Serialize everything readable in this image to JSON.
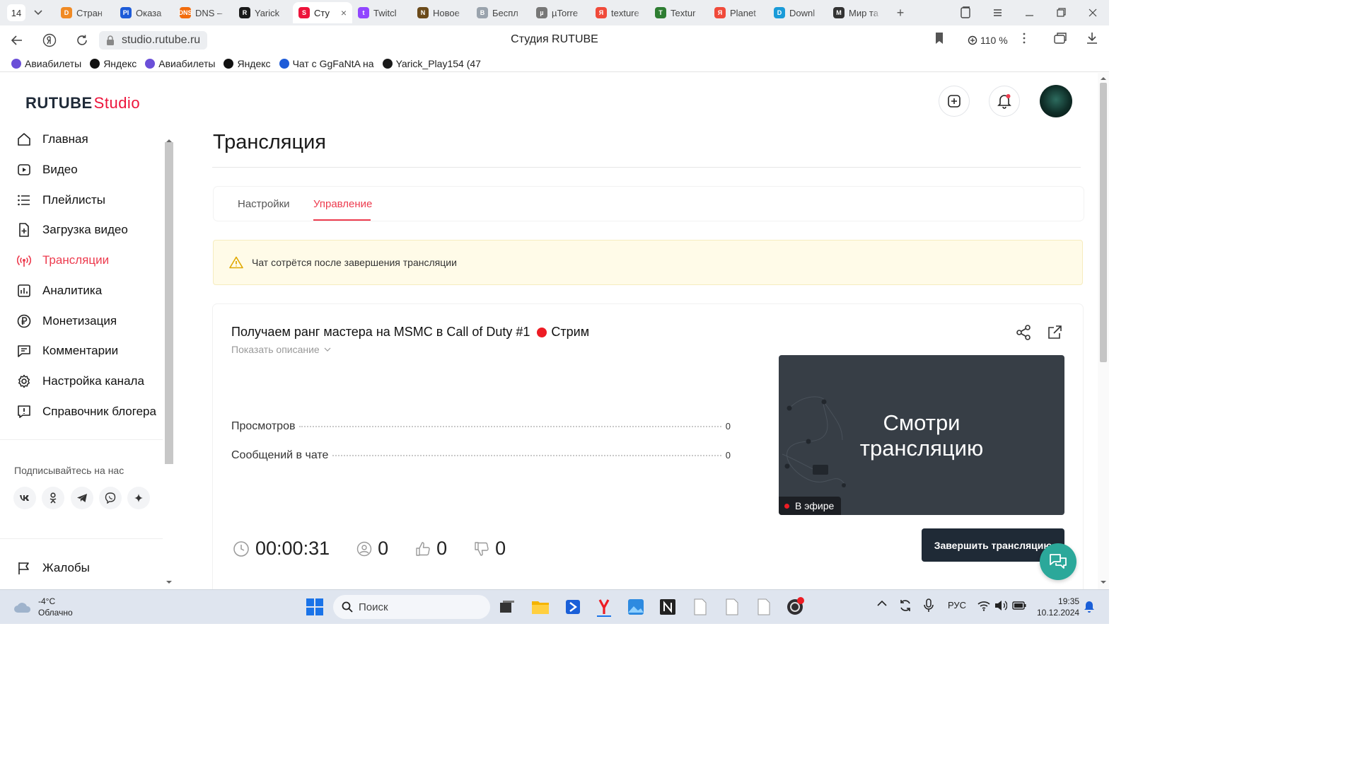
{
  "browser": {
    "tab_count": "14",
    "tabs": [
      {
        "title": "Стран",
        "color": "#f08a24",
        "letter": "D"
      },
      {
        "title": "Оказа",
        "color": "#1d5bd8",
        "letter": "PI"
      },
      {
        "title": "DNS –",
        "color": "#f26c0d",
        "letter": "DNS"
      },
      {
        "title": "Yarick",
        "color": "#1a1a1a",
        "letter": "R"
      },
      {
        "title": "Сту",
        "color": "#ed143b",
        "letter": "S"
      },
      {
        "title": "Twitcl",
        "color": "#9146ff",
        "letter": "t"
      },
      {
        "title": "Новое",
        "color": "#6b4a1a",
        "letter": "N"
      },
      {
        "title": "Беспл",
        "color": "#9aa3ad",
        "letter": "B"
      },
      {
        "title": "µTorre",
        "color": "#777777",
        "letter": "µ"
      },
      {
        "title": "texture",
        "color": "#f04a3a",
        "letter": "Я"
      },
      {
        "title": "Textur",
        "color": "#2e7d32",
        "letter": "T"
      },
      {
        "title": "Planet",
        "color": "#f04a3a",
        "letter": "Я"
      },
      {
        "title": "Downl",
        "color": "#1a9bd8",
        "letter": "D"
      },
      {
        "title": "Мир та",
        "color": "#333333",
        "letter": "M"
      }
    ],
    "active_tab_close": "×",
    "url": "studio.rutube.ru",
    "page_title": "Студия RUTUBE",
    "zoom": "110 %",
    "bookmarks": [
      {
        "label": "Авиабилеты",
        "color": "#6b4fd8"
      },
      {
        "label": "Яндекс",
        "color": "#111111"
      },
      {
        "label": "Авиабилеты",
        "color": "#6b4fd8"
      },
      {
        "label": "Яндекс",
        "color": "#111111"
      },
      {
        "label": "Чат с GgFaNtA на",
        "color": "#1d5bd8"
      },
      {
        "label": "Yarick_Play154 (47",
        "color": "#1a1a1a"
      }
    ]
  },
  "app": {
    "logo_main": "RUTUBE",
    "logo_sub": "Studio",
    "sidebar": {
      "items": [
        {
          "label": "Главная",
          "icon": "home-icon"
        },
        {
          "label": "Видео",
          "icon": "video-icon"
        },
        {
          "label": "Плейлисты",
          "icon": "list-icon"
        },
        {
          "label": "Загрузка видео",
          "icon": "upload-icon"
        },
        {
          "label": "Трансляции",
          "icon": "broadcast-icon",
          "active": true
        },
        {
          "label": "Аналитика",
          "icon": "analytics-icon"
        },
        {
          "label": "Монетизация",
          "icon": "ruble-icon"
        },
        {
          "label": "Комментарии",
          "icon": "comment-icon"
        },
        {
          "label": "Настройка канала",
          "icon": "gear-icon"
        },
        {
          "label": "Справочник блогера",
          "icon": "info-icon"
        }
      ],
      "follow_label": "Подписывайтесь на нас",
      "social": [
        "vk",
        "ok",
        "telegram",
        "viber",
        "more"
      ],
      "complaints": "Жалобы"
    },
    "page_heading": "Трансляция",
    "tabs": {
      "settings": "Настройки",
      "management": "Управление"
    },
    "warning": "Чат сотрётся после завершения трансляции",
    "stream": {
      "title": "Получаем ранг мастера на MSMC в Call of Duty #1",
      "badge": "Стрим",
      "show_description": "Показать описание",
      "stats": [
        {
          "label": "Просмотров",
          "value": "0"
        },
        {
          "label": "Сообщений в чате",
          "value": "0"
        }
      ],
      "preview_text_line1": "Смотри",
      "preview_text_line2": "трансляцию",
      "on_air": "В эфире",
      "duration": "00:00:31",
      "viewers": "0",
      "likes": "0",
      "dislikes": "0",
      "end_button": "Завершить трансляцию"
    },
    "accent_color": "#ed3b4e"
  },
  "taskbar": {
    "temperature": "-4°C",
    "weather": "Облачно",
    "search_placeholder": "Поиск",
    "language": "РУС",
    "time": "19:35",
    "date": "10.12.2024"
  }
}
